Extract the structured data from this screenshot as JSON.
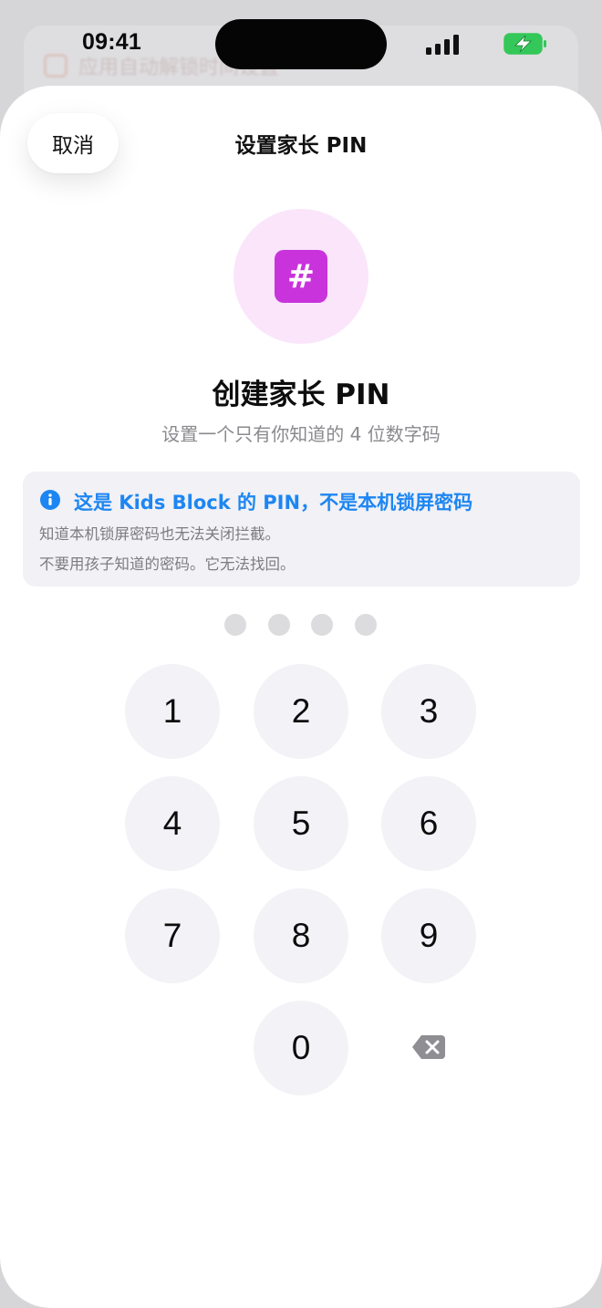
{
  "status_bar": {
    "time": "09:41"
  },
  "background": {
    "row_text": "应用自动解锁时间设置"
  },
  "sheet": {
    "cancel_label": "取消",
    "title": "设置家长 PIN",
    "badge_glyph": "#",
    "heading": "创建家长 PIN",
    "subheading": "设置一个只有你知道的 4 位数字码"
  },
  "info": {
    "title": "这是 Kids Block 的 PIN，不是本机锁屏密码",
    "line1": "知道本机锁屏密码也无法关闭拦截。",
    "line2": "不要用孩子知道的密码。它无法找回。"
  },
  "pin": {
    "length": 4,
    "filled": 0
  },
  "keypad": {
    "k1": "1",
    "k2": "2",
    "k3": "3",
    "k4": "4",
    "k5": "5",
    "k6": "6",
    "k7": "7",
    "k8": "8",
    "k9": "9",
    "k0": "0",
    "delete_icon": "delete-backspace-icon"
  },
  "colors": {
    "accent_blue": "#1d86f2",
    "badge_purple": "#c933dc",
    "badge_bg": "#fae5fb",
    "key_bg": "#f2f2f7",
    "dot_empty": "#dcdcdf",
    "battery_green": "#34c759"
  }
}
